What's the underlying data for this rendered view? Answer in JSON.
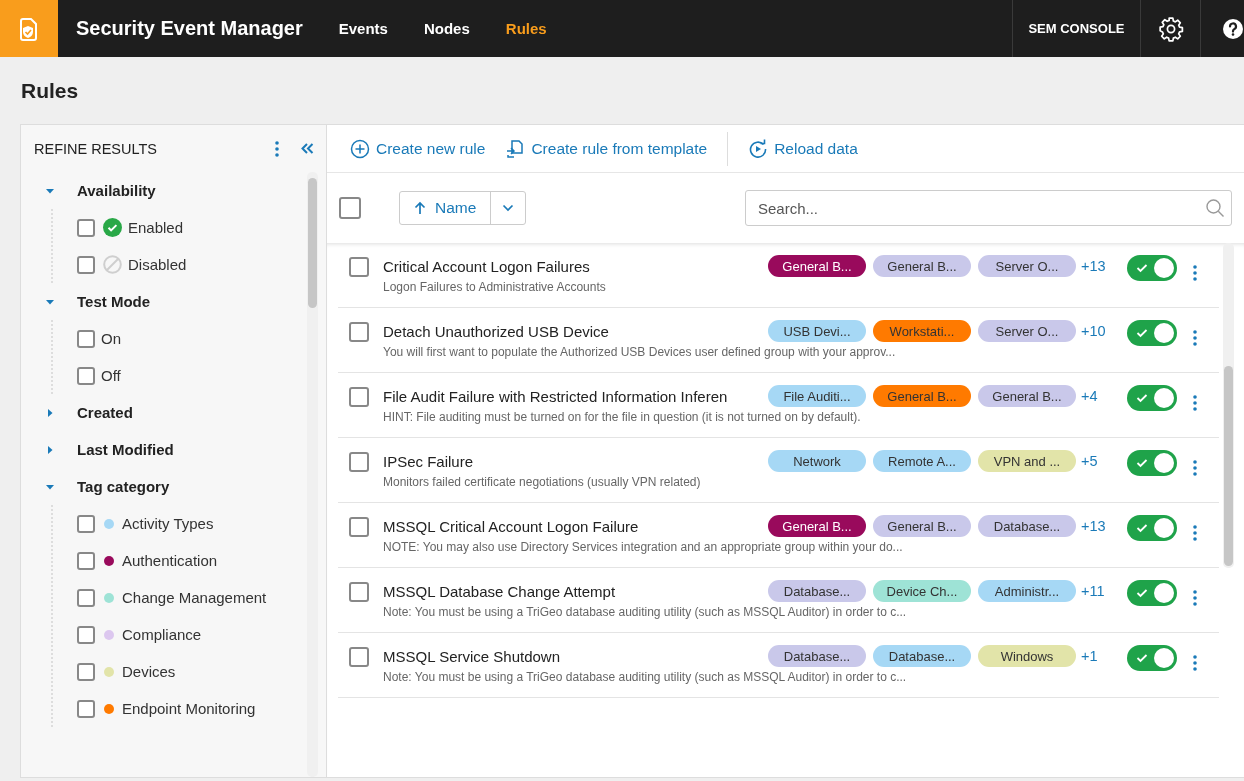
{
  "app": {
    "title": "Security Event Manager"
  },
  "nav": [
    {
      "label": "Events",
      "selected": false
    },
    {
      "label": "Nodes",
      "selected": false
    },
    {
      "label": "Rules",
      "selected": true
    }
  ],
  "console_button": "SEM CONSOLE",
  "page_title": "Rules",
  "filters": {
    "title": "REFINE RESULTS",
    "groups": [
      {
        "label": "Availability",
        "expanded": true,
        "items": [
          {
            "label": "Enabled",
            "checked": false,
            "kind": "enabled"
          },
          {
            "label": "Disabled",
            "checked": false,
            "kind": "disabled"
          }
        ]
      },
      {
        "label": "Test Mode",
        "expanded": true,
        "items": [
          {
            "label": "On",
            "checked": false,
            "kind": "plain"
          },
          {
            "label": "Off",
            "checked": false,
            "kind": "plain"
          }
        ]
      },
      {
        "label": "Created",
        "expanded": false
      },
      {
        "label": "Last Modified",
        "expanded": false
      },
      {
        "label": "Tag category",
        "expanded": true,
        "items": [
          {
            "label": "Activity Types",
            "checked": false,
            "kind": "tag",
            "color": "#a6d8f5"
          },
          {
            "label": "Authentication",
            "checked": false,
            "kind": "tag",
            "color": "#990a5c"
          },
          {
            "label": "Change Management",
            "checked": false,
            "kind": "tag",
            "color": "#9ee3d6"
          },
          {
            "label": "Compliance",
            "checked": false,
            "kind": "tag",
            "color": "#dcc7ef"
          },
          {
            "label": "Devices",
            "checked": false,
            "kind": "tag",
            "color": "#e2e4a9"
          },
          {
            "label": "Endpoint Monitoring",
            "checked": false,
            "kind": "tag",
            "color": "#ff7a00"
          }
        ]
      }
    ]
  },
  "toolbar": [
    "Create new rule",
    "Create rule from template",
    "Reload data"
  ],
  "list_header": {
    "select_all_checked": false,
    "sort": "Name",
    "search": {
      "placeholder": "Search..."
    }
  },
  "rules": [
    {
      "name": "Critical Account Logon Failures",
      "description": "Logon Failures to Administrative Accounts",
      "checked": false,
      "on": true,
      "more": "+13",
      "tags": [
        {
          "label": "General B...",
          "color": "#990a5c"
        },
        {
          "label": "General B...",
          "color": "#c9c8ea"
        },
        {
          "label": "Server O...",
          "color": "#c9c8ea"
        }
      ]
    },
    {
      "name": "Detach Unauthorized USB Device",
      "description": "You will first want to populate the Authorized USB Devices user defined group with your approv...",
      "checked": false,
      "on": true,
      "more": "+10",
      "tags": [
        {
          "label": "USB Devi...",
          "color": "#a6d8f5"
        },
        {
          "label": "Workstati...",
          "color": "#ff7a00"
        },
        {
          "label": "Server O...",
          "color": "#c9c8ea"
        }
      ]
    },
    {
      "name": "File Audit Failure with Restricted Information Inferen",
      "description": "HINT: File auditing must be turned on for the file in question (it is not turned on by default).",
      "checked": false,
      "on": true,
      "more": "+4",
      "tags": [
        {
          "label": "File Auditi...",
          "color": "#a6d8f5"
        },
        {
          "label": "General B...",
          "color": "#ff7a00"
        },
        {
          "label": "General B...",
          "color": "#c9c8ea"
        }
      ]
    },
    {
      "name": "IPSec Failure",
      "description": "Monitors failed certificate negotiations (usually VPN related)",
      "checked": false,
      "on": true,
      "more": "+5",
      "tags": [
        {
          "label": "Network",
          "color": "#a6d8f5"
        },
        {
          "label": "Remote A...",
          "color": "#a6d8f5"
        },
        {
          "label": "VPN and ...",
          "color": "#e2e4a9"
        }
      ]
    },
    {
      "name": "MSSQL Critical Account Logon Failure",
      "description": "NOTE: You may also use Directory Services integration and an appropriate group within your do...",
      "checked": false,
      "on": true,
      "more": "+13",
      "tags": [
        {
          "label": "General B...",
          "color": "#990a5c"
        },
        {
          "label": "General B...",
          "color": "#c9c8ea"
        },
        {
          "label": "Database...",
          "color": "#c9c8ea"
        }
      ]
    },
    {
      "name": "MSSQL Database Change Attempt",
      "description": "Note: You must be using a TriGeo database auditing utility (such as MSSQL Auditor) in order to c...",
      "checked": false,
      "on": true,
      "more": "+11",
      "tags": [
        {
          "label": "Database...",
          "color": "#c9c8ea"
        },
        {
          "label": "Device Ch...",
          "color": "#9ee3d6"
        },
        {
          "label": "Administr...",
          "color": "#a6d8f5"
        }
      ]
    },
    {
      "name": "MSSQL Service Shutdown",
      "description": "Note: You must be using a TriGeo database auditing utility (such as MSSQL Auditor) in order to c...",
      "checked": false,
      "on": true,
      "more": "+1",
      "tags": [
        {
          "label": "Database...",
          "color": "#c9c8ea"
        },
        {
          "label": "Database...",
          "color": "#a6d8f5"
        },
        {
          "label": "Windows",
          "color": "#e2e4a9"
        }
      ]
    }
  ]
}
